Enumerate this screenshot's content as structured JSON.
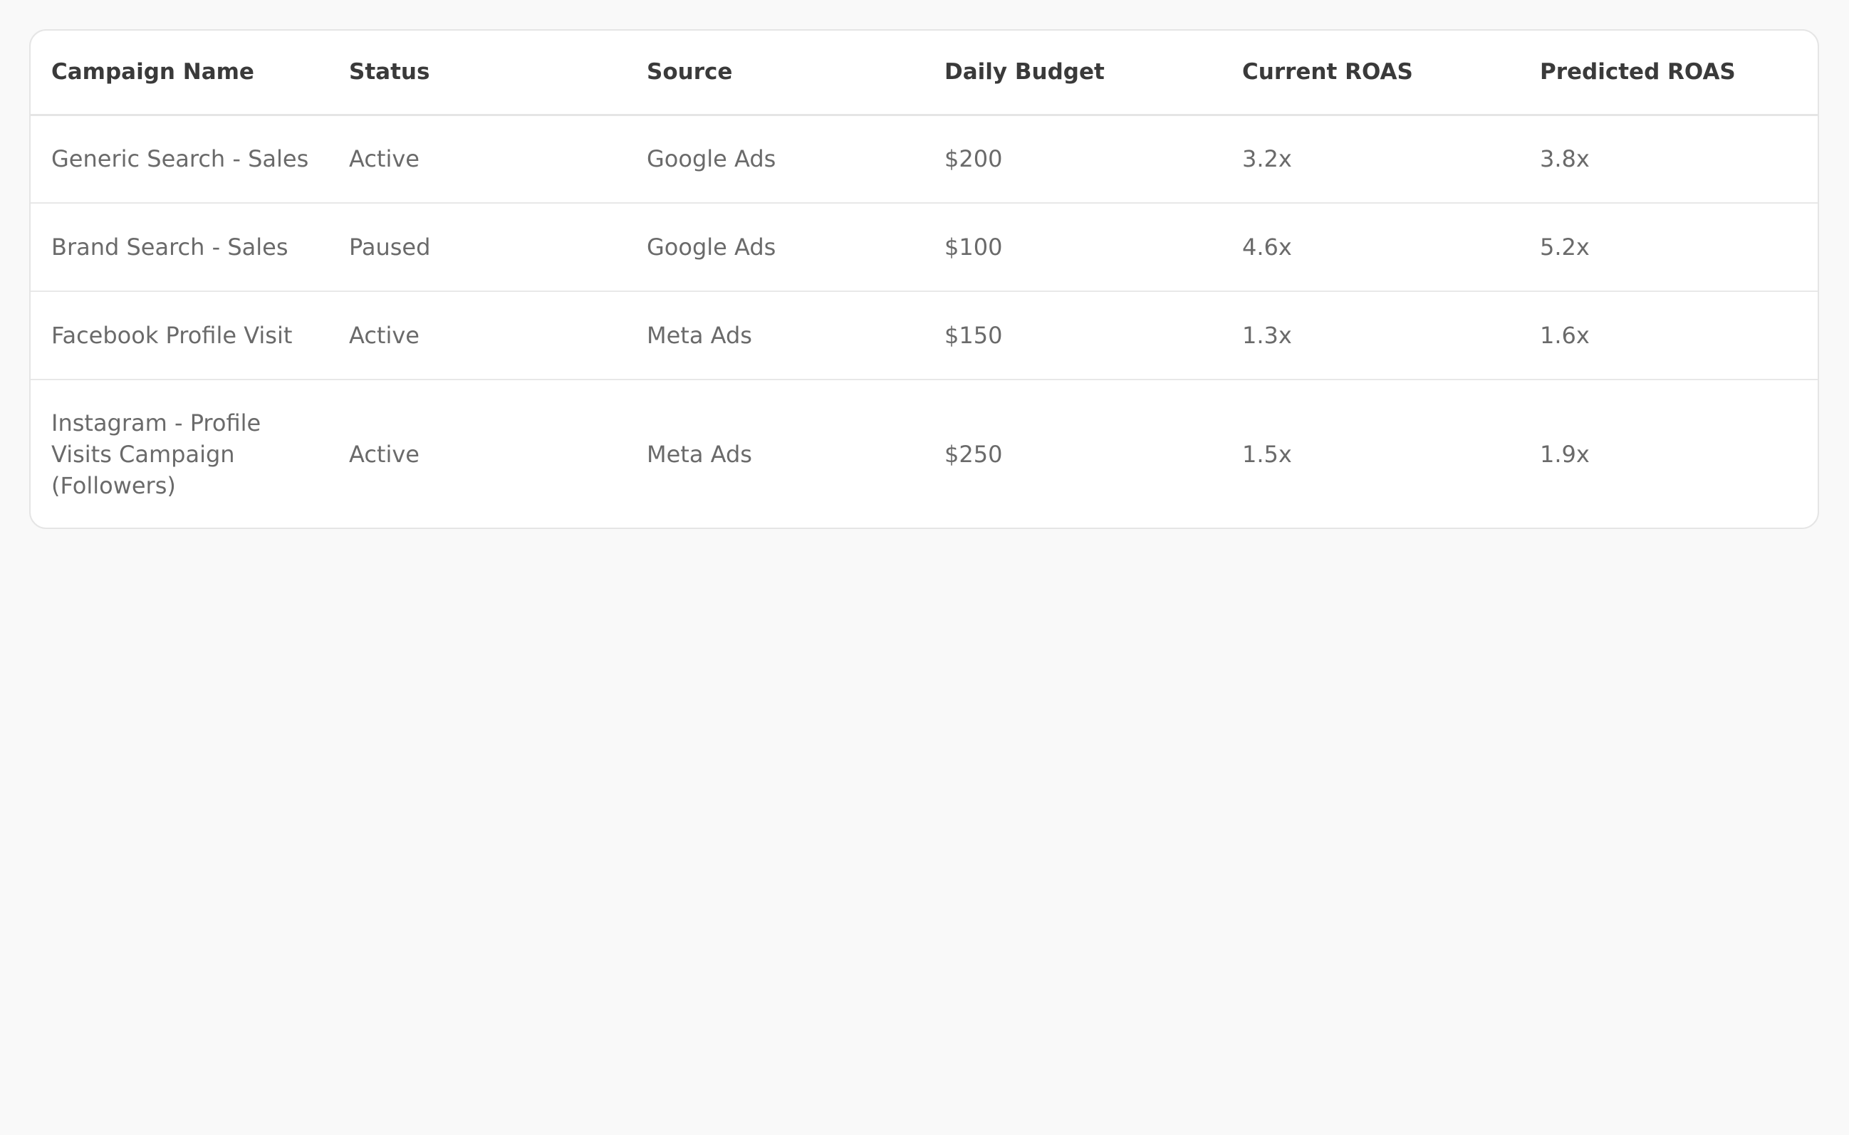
{
  "table": {
    "columns": [
      "Campaign Name",
      "Status",
      "Source",
      "Daily Budget",
      "Current ROAS",
      "Predicted ROAS"
    ],
    "rows": [
      {
        "name": "Generic Search - Sales",
        "status": "Active",
        "source": "Google Ads",
        "budget": "$200",
        "current_roas": "3.2x",
        "predicted_roas": "3.8x"
      },
      {
        "name": "Brand Search - Sales",
        "status": "Paused",
        "source": "Google Ads",
        "budget": "$100",
        "current_roas": "4.6x",
        "predicted_roas": "5.2x"
      },
      {
        "name": "Facebook Profile Visit",
        "status": "Active",
        "source": "Meta Ads",
        "budget": "$150",
        "current_roas": "1.3x",
        "predicted_roas": "1.6x"
      },
      {
        "name": "Instagram - Profile Visits Campaign (Followers)",
        "status": "Active",
        "source": "Meta Ads",
        "budget": "$250",
        "current_roas": "1.5x",
        "predicted_roas": "1.9x"
      }
    ]
  }
}
